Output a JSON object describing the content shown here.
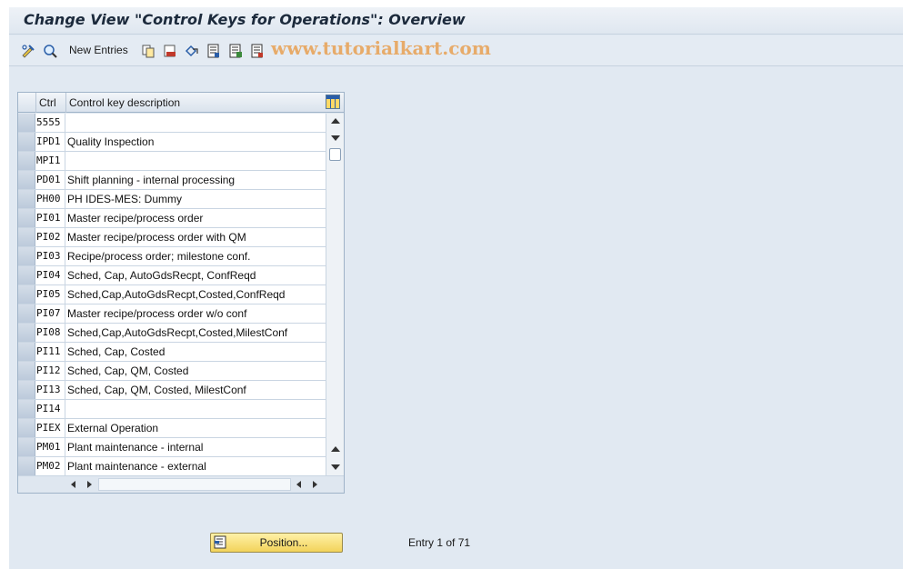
{
  "title": "Change View \"Control Keys for Operations\": Overview",
  "toolbar": {
    "new_entries_label": "New Entries",
    "watermark": "www.tutorialkart.com",
    "icons": [
      "display-change-icon",
      "details-icon",
      "copy-icon",
      "delete-icon",
      "undo-change-icon",
      "select-all-icon",
      "select-block-icon",
      "deselect-all-icon"
    ]
  },
  "table": {
    "columns": [
      "Ctrl",
      "Control key description"
    ],
    "rows": [
      {
        "key": "5555",
        "desc": ""
      },
      {
        "key": "IPD1",
        "desc": "Quality Inspection"
      },
      {
        "key": "MPI1",
        "desc": ""
      },
      {
        "key": "PD01",
        "desc": "Shift planning - internal processing"
      },
      {
        "key": "PH00",
        "desc": "PH IDES-MES: Dummy"
      },
      {
        "key": "PI01",
        "desc": "Master recipe/process order"
      },
      {
        "key": "PI02",
        "desc": "Master recipe/process order with QM"
      },
      {
        "key": "PI03",
        "desc": "Recipe/process order; milestone conf."
      },
      {
        "key": "PI04",
        "desc": "Sched, Cap, AutoGdsRecpt, ConfReqd"
      },
      {
        "key": "PI05",
        "desc": "Sched,Cap,AutoGdsRecpt,Costed,ConfReqd"
      },
      {
        "key": "PI07",
        "desc": "Master recipe/process order w/o conf"
      },
      {
        "key": "PI08",
        "desc": "Sched,Cap,AutoGdsRecpt,Costed,MilestConf"
      },
      {
        "key": "PI11",
        "desc": "Sched, Cap, Costed"
      },
      {
        "key": "PI12",
        "desc": "Sched, Cap, QM, Costed"
      },
      {
        "key": "PI13",
        "desc": "Sched, Cap, QM, Costed, MilestConf"
      },
      {
        "key": "PI14",
        "desc": ""
      },
      {
        "key": "PIEX",
        "desc": "External Operation"
      },
      {
        "key": "PM01",
        "desc": "Plant maintenance - internal"
      },
      {
        "key": "PM02",
        "desc": "Plant maintenance - external"
      }
    ]
  },
  "footer": {
    "position_label": "Position...",
    "entry_info": "Entry 1 of 71"
  }
}
